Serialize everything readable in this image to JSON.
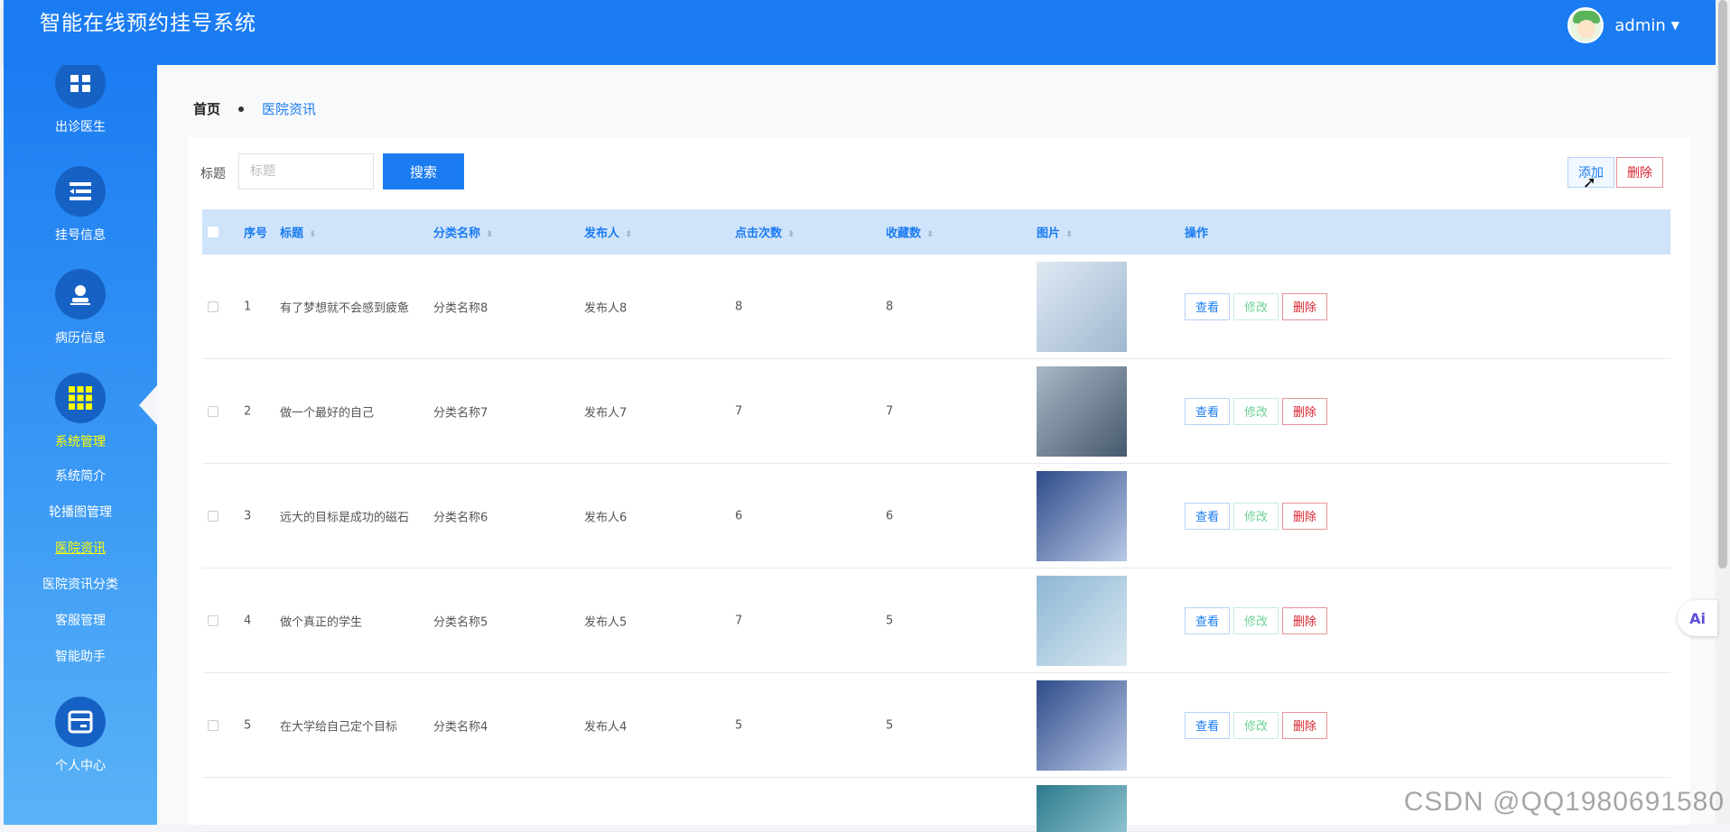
{
  "app": {
    "title": "智能在线预约挂号系统",
    "user": "admin"
  },
  "sidebar": {
    "groups": [
      {
        "label": "出诊医生",
        "icon": "grid-icon"
      },
      {
        "label": "挂号信息",
        "icon": "list-icon"
      },
      {
        "label": "病历信息",
        "icon": "person-icon"
      },
      {
        "label": "系统管理",
        "icon": "apps-icon",
        "active": true
      },
      {
        "label": "个人中心",
        "icon": "card-icon"
      }
    ],
    "submenu": [
      "系统简介",
      "轮播图管理",
      "医院资讯",
      "医院资讯分类",
      "客服管理",
      "智能助手"
    ],
    "active_sub": "医院资讯"
  },
  "breadcrumb": {
    "home": "首页",
    "current": "医院资讯"
  },
  "search": {
    "label": "标题",
    "placeholder": "标题",
    "button": "搜索"
  },
  "actions": {
    "add": "添加",
    "delete": "删除"
  },
  "table": {
    "headers": [
      "序号",
      "标题",
      "分类名称",
      "发布人",
      "点击次数",
      "收藏数",
      "图片",
      "操作"
    ],
    "rows": [
      {
        "no": "1",
        "title": "有了梦想就不会感到疲惫",
        "category": "分类名称8",
        "publisher": "发布人8",
        "clicks": "8",
        "favorites": "8"
      },
      {
        "no": "2",
        "title": "做一个最好的自己",
        "category": "分类名称7",
        "publisher": "发布人7",
        "clicks": "7",
        "favorites": "7"
      },
      {
        "no": "3",
        "title": "远大的目标是成功的磁石",
        "category": "分类名称6",
        "publisher": "发布人6",
        "clicks": "6",
        "favorites": "6"
      },
      {
        "no": "4",
        "title": "做个真正的学生",
        "category": "分类名称5",
        "publisher": "发布人5",
        "clicks": "7",
        "favorites": "5"
      },
      {
        "no": "5",
        "title": "在大学给自己定个目标",
        "category": "分类名称4",
        "publisher": "发布人4",
        "clicks": "5",
        "favorites": "5"
      }
    ],
    "op_labels": {
      "view": "查看",
      "edit": "修改",
      "delete": "删除"
    }
  },
  "watermark": "CSDN @QQ1980691580",
  "ai_badge": "Ai",
  "colors": {
    "primary": "#1b7cf2",
    "danger": "#d9232e",
    "success": "#6cd19a",
    "active_nav": "#ffff00"
  }
}
